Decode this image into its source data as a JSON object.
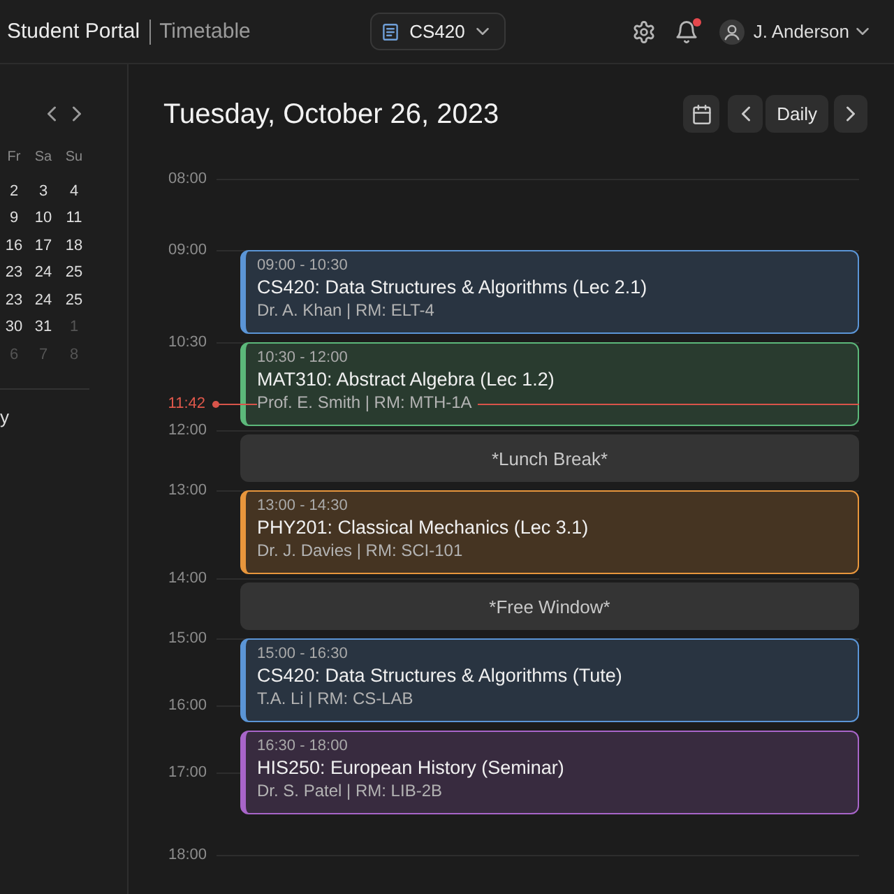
{
  "top_bar": {
    "title": "Student Portal",
    "section": "Timetable",
    "course_selector": {
      "label": "CS420"
    },
    "notifications": {
      "unread": true
    },
    "user": {
      "name": "J. Anderson"
    }
  },
  "sidebar": {
    "calendar": {
      "weekdays": [
        "Fr",
        "Sa",
        "Su"
      ],
      "weeks": [
        [
          {
            "day": "2",
            "muted": false
          },
          {
            "day": "3",
            "muted": false
          },
          {
            "day": "4",
            "muted": false
          }
        ],
        [
          {
            "day": "9",
            "muted": false
          },
          {
            "day": "10",
            "muted": false
          },
          {
            "day": "11",
            "muted": false
          }
        ],
        [
          {
            "day": "16",
            "muted": false
          },
          {
            "day": "17",
            "muted": false
          },
          {
            "day": "18",
            "muted": false
          }
        ],
        [
          {
            "day": "23",
            "muted": false
          },
          {
            "day": "24",
            "muted": false
          },
          {
            "day": "25",
            "muted": false
          }
        ],
        [
          {
            "day": "23",
            "muted": false
          },
          {
            "day": "24",
            "muted": false
          },
          {
            "day": "25",
            "muted": false
          }
        ],
        [
          {
            "day": "30",
            "muted": false
          },
          {
            "day": "31",
            "muted": false
          },
          {
            "day": "1",
            "muted": true
          }
        ],
        [
          {
            "day": "6",
            "muted": true
          },
          {
            "day": "7",
            "muted": true
          },
          {
            "day": "8",
            "muted": true
          }
        ]
      ]
    },
    "section_label": "y"
  },
  "day_view": {
    "title": "Tuesday, October 26, 2023",
    "view_mode": "Daily",
    "time_labels": [
      "08:00",
      "09:00",
      "10:30",
      "12:00",
      "13:00",
      "14:00",
      "15:00",
      "16:00",
      "17:00",
      "18:00"
    ],
    "now": {
      "time": "11:42"
    },
    "events": [
      {
        "kind": "class",
        "time": "09:00 - 10:30",
        "title": "CS420: Data Structures & Algorithms (Lec 2.1)",
        "details": "Dr. A. Khan | RM: ELT-4",
        "color": "#5b95d6"
      },
      {
        "kind": "class",
        "time": "10:30 - 12:00",
        "title": "MAT310: Abstract Algebra (Lec 1.2)",
        "details": "Prof. E. Smith | RM: MTH-1A",
        "color": "#5cb87a"
      },
      {
        "kind": "break",
        "label": "*Lunch Break*"
      },
      {
        "kind": "class",
        "time": "13:00 - 14:30",
        "title": "PHY201: Classical Mechanics (Lec 3.1)",
        "details": "Dr. J. Davies | RM: SCI-101",
        "color": "#e8963c"
      },
      {
        "kind": "break",
        "label": "*Free Window*"
      },
      {
        "kind": "class",
        "time": "15:00 - 16:30",
        "title": "CS420: Data Structures & Algorithms (Tute)",
        "details": "T.A. Li | RM: CS-LAB",
        "color": "#5b95d6"
      },
      {
        "kind": "class",
        "time": "16:30 - 18:00",
        "title": "HIS250: European History (Seminar)",
        "details": "Dr. S. Patel | RM: LIB-2B",
        "color": "#a865c9"
      }
    ]
  }
}
